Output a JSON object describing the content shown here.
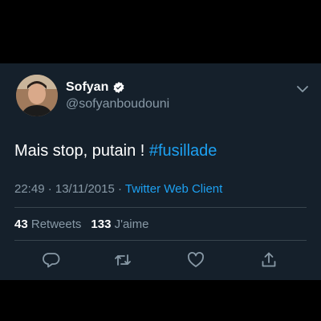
{
  "tweet": {
    "author": {
      "display_name": "Sofyan",
      "handle": "@sofyanboudouni",
      "verified_icon": "verified-badge-icon",
      "avatar": "profile-photo"
    },
    "text": "Mais stop, putain ! ",
    "hashtag": "#fusillade",
    "timestamp": "22:49 · 13/11/2015 · ",
    "client": "Twitter Web Client",
    "stats": {
      "retweets_count": "43",
      "retweets_label": "Retweets",
      "likes_count": "133",
      "likes_label": "J'aime"
    },
    "actions": [
      "reply-icon",
      "retweet-icon",
      "like-icon",
      "share-icon"
    ],
    "menu_icon": "chevron-down-icon"
  },
  "colors": {
    "background": "#15202b",
    "text": "#ffffff",
    "secondary_text": "#8899a6",
    "accent": "#1da1f2",
    "divider": "#38444d"
  }
}
